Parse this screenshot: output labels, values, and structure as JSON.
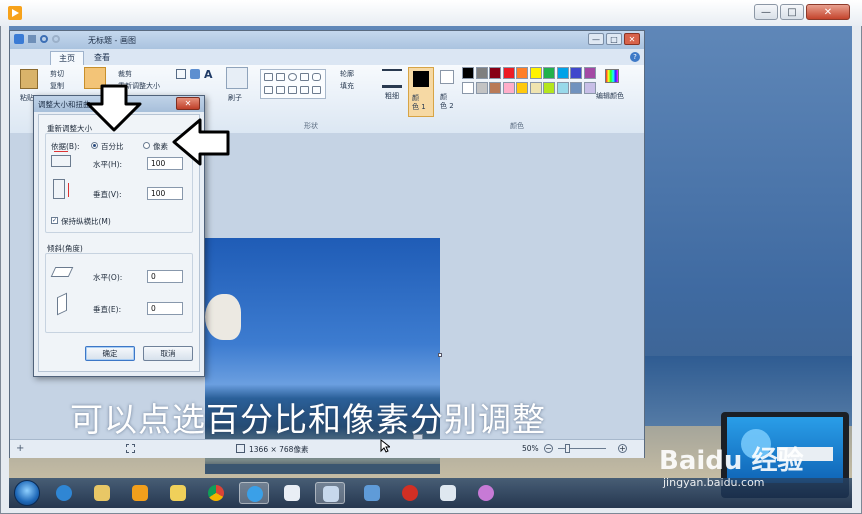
{
  "viewer": {
    "window_buttons": {
      "minimize": "—",
      "maximize": "□",
      "close": "✕"
    }
  },
  "paint": {
    "title": "无标题 - 画图",
    "file_menu": "▬ ▾",
    "tabs": [
      "主页",
      "查看"
    ],
    "help": "?",
    "clipboard": {
      "paste": "粘贴",
      "cut": "剪切",
      "copy": "复制"
    },
    "image": {
      "crop": "裁剪",
      "resize": "重新调整大小"
    },
    "tools": {
      "brush": "刷子"
    },
    "shapes": {
      "outline": "轮廓",
      "fill": "填充",
      "group": "形状"
    },
    "size_label": "粗细",
    "color1": "颜\n色 1",
    "color2": "颜\n色 2",
    "edit_colors": "编辑颜色",
    "colors_group": "颜色",
    "palette_row1": [
      "#000000",
      "#7f7f7f",
      "#880015",
      "#ed1c24",
      "#ff7f27",
      "#fff200",
      "#22b14c",
      "#00a2e8",
      "#3f48cc",
      "#a349a4"
    ],
    "palette_row2": [
      "#ffffff",
      "#c3c3c3",
      "#b97a57",
      "#ffaec9",
      "#ffc90e",
      "#efe4b0",
      "#b5e61d",
      "#99d9ea",
      "#7092be",
      "#c8bfe7"
    ],
    "status": {
      "dimensions": "1366 × 768像素",
      "zoom": "50%"
    }
  },
  "dialog": {
    "title": "调整大小和扭曲",
    "resize_section": "重新调整大小",
    "by_label": "依据(B):",
    "percent_label": "百分比",
    "pixel_label": "像素",
    "horizontal_label": "水平(H):",
    "horizontal_value": "100",
    "vertical_label": "垂直(V):",
    "vertical_value": "100",
    "keep_ratio_label": "保持纵横比(M)",
    "keep_ratio_checked": true,
    "skew_section": "倾斜(角度)",
    "skew_h_label": "水平(O):",
    "skew_h_value": "0",
    "skew_v_label": "垂直(E):",
    "skew_v_value": "0",
    "ok": "确定",
    "cancel": "取消"
  },
  "caption": "可以点选百分比和像素分别调整",
  "watermark": {
    "brand": "Baidu 经验",
    "url": "jingyan.baidu.com"
  }
}
